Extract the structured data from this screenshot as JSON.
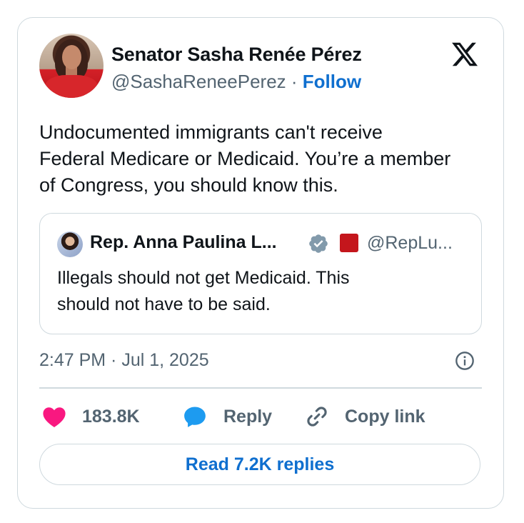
{
  "author": {
    "name": "Senator Sasha Renée Pérez",
    "handle": "@SashaReneePerez",
    "separator": " · ",
    "follow_label": "Follow"
  },
  "tweet": {
    "line1": "Undocumented immigrants can't receive",
    "line2": "Federal Medicare or Medicaid. You’re a member",
    "line3": "of Congress, you should know this."
  },
  "quoted": {
    "name": "Rep. Anna Paulina L...",
    "handle": "@RepLu...",
    "line1": "Illegals should not get Medicaid. This",
    "line2": "should not have to be said."
  },
  "timestamp": "2:47 PM · Jul 1, 2025",
  "actions": {
    "like_count": "183.8K",
    "reply_label": "Reply",
    "copy_label": "Copy link"
  },
  "read_replies_label": "Read 7.2K replies",
  "icons": {
    "x_logo": "x-logo-icon",
    "verified": "verified-badge-icon",
    "flag": "flag-icon",
    "info": "info-icon",
    "heart": "heart-icon",
    "reply": "speech-bubble-icon",
    "copy": "link-icon"
  },
  "colors": {
    "accent": "#0f6fcf",
    "heart": "#f91880",
    "reply": "#1d9bf0",
    "muted": "#536471",
    "border": "#cfd9de"
  }
}
